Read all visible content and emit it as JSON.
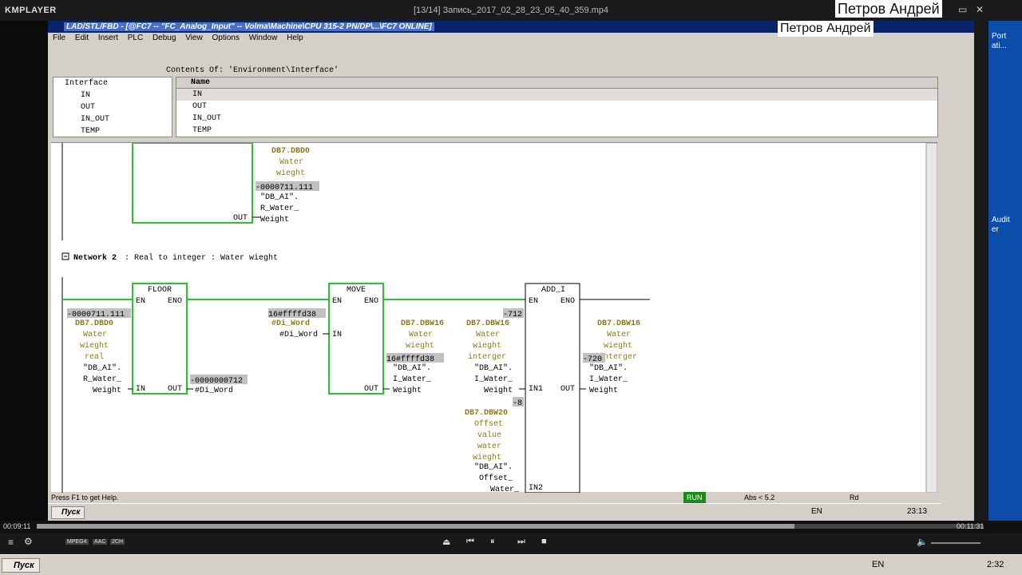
{
  "player": {
    "logo": "KMPLAYER",
    "file_title": "[13/14] Запись_2017_02_28_23_05_40_359.mp4",
    "overlay_name": "Петров Андрей",
    "time_elapsed": "00:09:11",
    "time_total": "00:11:31",
    "progress_fraction": 0.8,
    "badges": [
      "MPEG4",
      "AAC",
      "2CH"
    ],
    "lang": "EN",
    "clock": "2:32"
  },
  "s7": {
    "window_title": "LAD/STL/FBD - [@FC7 -- \"FC_Analog_Input\" -- Volma\\Machine\\CPU 315-2 PN/DP\\...\\FC7 ONLINE]",
    "menu": [
      "File",
      "Edit",
      "Insert",
      "PLC",
      "Debug",
      "View",
      "Options",
      "Window",
      "Help"
    ],
    "contents_of": "Contents Of: 'Environment\\Interface'",
    "tree": [
      "Interface",
      "IN",
      "OUT",
      "IN_OUT",
      "TEMP"
    ],
    "names_header": "Name",
    "names": [
      "IN",
      "OUT",
      "IN_OUT",
      "TEMP"
    ],
    "status_help": "Press F1 to get Help.",
    "status_run": "RUN",
    "status_abs": "Abs < 5.2",
    "status_rd": "Rd",
    "tray_lang": "EN",
    "tray_time": "23:13",
    "start": "Пуск"
  },
  "net1": {
    "op_addr": "DB7.DBD0",
    "op_comment": [
      "Water",
      "wieght"
    ],
    "value": "-0000711.111",
    "symbol": [
      "\"DB_AI\".",
      "R_Water_",
      "Weight"
    ],
    "out_label": "OUT"
  },
  "net2": {
    "title_label": "Network 2",
    "title": ": Real to integer : Water wieght",
    "floor": {
      "name": "FLOOR",
      "en": "EN",
      "eno": "ENO",
      "in": "IN",
      "out": "OUT",
      "in_value": "-0000711.111",
      "in_addr": "DB7.DBD0",
      "in_comment": [
        "Water",
        "wieght",
        "real"
      ],
      "in_symbol": [
        "\"DB_AI\".",
        "R_Water_",
        "Weight"
      ],
      "out_value": "-0000000712",
      "out_symbol": "#Di_Word"
    },
    "move": {
      "name": "MOVE",
      "en": "EN",
      "eno": "ENO",
      "in": "IN",
      "out": "OUT",
      "in_value": "16#ffffd38",
      "in_addr": "#Di_Word",
      "in_symbol": "#Di_Word",
      "out_addr": "DB7.DBW16",
      "out_comment": [
        "Water",
        "wieght"
      ],
      "out_value": "16#ffffd38",
      "out_symbol": [
        "\"DB_AI\".",
        "I_Water_",
        "Weight"
      ]
    },
    "add": {
      "name": "ADD_I",
      "en": "EN",
      "eno": "ENO",
      "in1": "IN1",
      "in2": "IN2",
      "out": "OUT",
      "in1_value": "-712",
      "in1_addr": "DB7.DBW16",
      "in1_comment": [
        "Water",
        "wieght",
        "interger"
      ],
      "in1_symbol": [
        "\"DB_AI\".",
        "I_Water_",
        "Weight"
      ],
      "in2_value": "-8",
      "in2_addr": "DB7.DBW20",
      "in2_comment": [
        "Offset",
        "value",
        "water",
        "wieght"
      ],
      "in2_symbol": [
        "\"DB_AI\".",
        "Offset_",
        "Water_"
      ],
      "out_addr": "DB7.DBW16",
      "out_comment": [
        "Water",
        "wieght",
        "interger"
      ],
      "out_value": "-720",
      "out_symbol": [
        "\"DB_AI\".",
        "I_Water_",
        "Weight"
      ]
    }
  },
  "desktop": {
    "right_labels": [
      "Port",
      "ati...",
      "Audit",
      "er"
    ]
  }
}
